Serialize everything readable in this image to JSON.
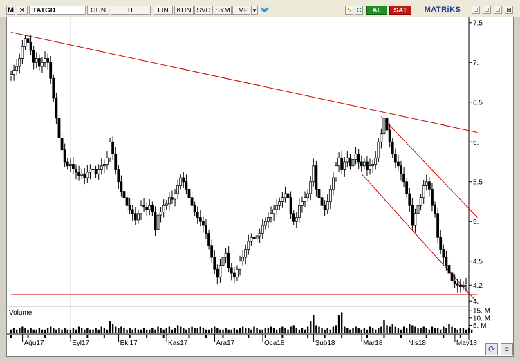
{
  "toolbar": {
    "menu_glyph": "M",
    "close_glyph": "✕",
    "symbol": "TATGD",
    "period": "GUN",
    "currency": "TL",
    "scale": "LIN",
    "khn": "KHN",
    "svd": "SVD",
    "sym": "SYM",
    "tmp": "TMP",
    "dropdown_glyph": "▼",
    "lightning_glyph": "ϟ",
    "refresh_glyph": "C",
    "buy_label": "AL",
    "sell_label": "SAT",
    "brand": "MATRiKS",
    "buy_color": "#1f8f1f",
    "sell_color": "#c01818"
  },
  "window_controls": [
    "□",
    "□",
    "□",
    "⊠"
  ],
  "corner_buttons": [
    "⟳",
    "≡"
  ],
  "chart_data": {
    "type": "candlestick",
    "symbol": "TATGD",
    "y_ticks": [
      7.5,
      7,
      6.5,
      6,
      5.5,
      5,
      4.5,
      4.2,
      4
    ],
    "y_tick_labels": [
      "7.5",
      "7.",
      "6.5",
      "6.",
      "5.5",
      "5.",
      "4.5",
      "4.2",
      "4."
    ],
    "ylim": [
      3.95,
      7.55
    ],
    "x_labels": [
      "Ağu17",
      "Eyl17",
      "Eki17",
      "Kas17",
      "Ara17",
      "Oca18",
      "Şub18",
      "Mar18",
      "Nis18",
      "May18"
    ],
    "close_series": [
      6.85,
      6.9,
      6.95,
      7.05,
      7.2,
      7.3,
      7.25,
      7.15,
      7.0,
      7.05,
      6.95,
      7.0,
      7.05,
      7.0,
      6.8,
      6.55,
      6.3,
      6.05,
      5.9,
      5.75,
      5.7,
      5.72,
      5.66,
      5.62,
      5.58,
      5.6,
      5.55,
      5.62,
      5.66,
      5.65,
      5.6,
      5.65,
      5.7,
      5.72,
      5.8,
      6.0,
      5.85,
      5.65,
      5.5,
      5.38,
      5.3,
      5.2,
      5.15,
      5.1,
      5.02,
      5.1,
      5.2,
      5.18,
      5.15,
      5.2,
      5.12,
      4.9,
      5.08,
      5.12,
      5.2,
      5.22,
      5.3,
      5.28,
      5.35,
      5.45,
      5.55,
      5.5,
      5.4,
      5.3,
      5.2,
      5.12,
      5.05,
      5.0,
      4.95,
      4.85,
      4.7,
      4.55,
      4.4,
      4.3,
      4.45,
      4.55,
      4.6,
      4.42,
      4.35,
      4.3,
      4.4,
      4.5,
      4.55,
      4.65,
      4.75,
      4.8,
      4.78,
      4.82,
      4.85,
      4.95,
      5.0,
      5.05,
      5.1,
      5.15,
      5.2,
      5.25,
      5.3,
      5.35,
      5.3,
      5.1,
      5.0,
      5.05,
      5.2,
      5.25,
      5.3,
      5.35,
      5.5,
      5.7,
      5.4,
      5.3,
      5.2,
      5.15,
      5.25,
      5.4,
      5.55,
      5.7,
      5.8,
      5.65,
      5.75,
      5.8,
      5.7,
      5.78,
      5.85,
      5.75,
      5.7,
      5.75,
      5.65,
      5.7,
      5.72,
      5.8,
      6.0,
      6.1,
      6.3,
      6.15,
      6.0,
      5.85,
      5.75,
      5.7,
      5.6,
      5.5,
      5.35,
      5.2,
      4.95,
      5.1,
      5.2,
      5.3,
      5.45,
      5.5,
      5.4,
      5.2,
      5.1,
      4.8,
      4.65,
      4.55,
      4.45,
      4.35,
      4.25,
      4.22,
      4.2,
      4.18,
      4.2,
      4.22
    ],
    "trendlines": [
      {
        "from": {
          "x_index": 0,
          "y": 7.38
        },
        "to": {
          "x_index": 165,
          "y": 6.12
        },
        "color": "#cc0000"
      },
      {
        "from": {
          "x_index": 131,
          "y": 6.32
        },
        "to": {
          "x_index": 165,
          "y": 5.05
        },
        "color": "#cc0000"
      },
      {
        "from": {
          "x_index": 124,
          "y": 5.6
        },
        "to": {
          "x_index": 165,
          "y": 3.98
        },
        "color": "#cc0000"
      },
      {
        "from": {
          "x_index": 0,
          "y": 4.08
        },
        "to": {
          "x_index": 165,
          "y": 4.08
        },
        "color": "#cc0000"
      }
    ],
    "vertical_cursor_index": 21,
    "volume": {
      "label": "Volume",
      "tick_labels": [
        "15. M",
        "10. M",
        "5. M"
      ],
      "tick_values": [
        15,
        10,
        5
      ],
      "unit": "M",
      "values": [
        2,
        3,
        2,
        3,
        4,
        3,
        2,
        3,
        2,
        2,
        3,
        2,
        2,
        3,
        4,
        3,
        2,
        3,
        2,
        3,
        2,
        2,
        3,
        2,
        4,
        3,
        2,
        3,
        2,
        2,
        3,
        2,
        4,
        3,
        2,
        8,
        6,
        4,
        3,
        4,
        3,
        2,
        3,
        2,
        3,
        2,
        2,
        3,
        2,
        2,
        3,
        2,
        4,
        3,
        2,
        3,
        4,
        2,
        3,
        5,
        4,
        3,
        2,
        3,
        4,
        3,
        3,
        4,
        3,
        2,
        2,
        3,
        4,
        3,
        2,
        2,
        3,
        2,
        2,
        3,
        2,
        3,
        4,
        3,
        3,
        2,
        4,
        3,
        2,
        2,
        3,
        3,
        4,
        3,
        2,
        3,
        4,
        3,
        2,
        4,
        5,
        3,
        2,
        3,
        2,
        4,
        8,
        12,
        5,
        4,
        3,
        2,
        3,
        2,
        4,
        5,
        12,
        14,
        4,
        3,
        2,
        3,
        4,
        3,
        2,
        3,
        2,
        4,
        3,
        2,
        3,
        4,
        9,
        5,
        4,
        6,
        4,
        3,
        2,
        4,
        3,
        6,
        5,
        4,
        3,
        3,
        4,
        3,
        2,
        4,
        3,
        3,
        2,
        4,
        3,
        6,
        4,
        3,
        2,
        3,
        3,
        2,
        3,
        2
      ]
    },
    "grid": false,
    "colors": {
      "up": "#000000",
      "down": "#000000",
      "trend": "#cc0000",
      "volume": "#000000"
    }
  }
}
